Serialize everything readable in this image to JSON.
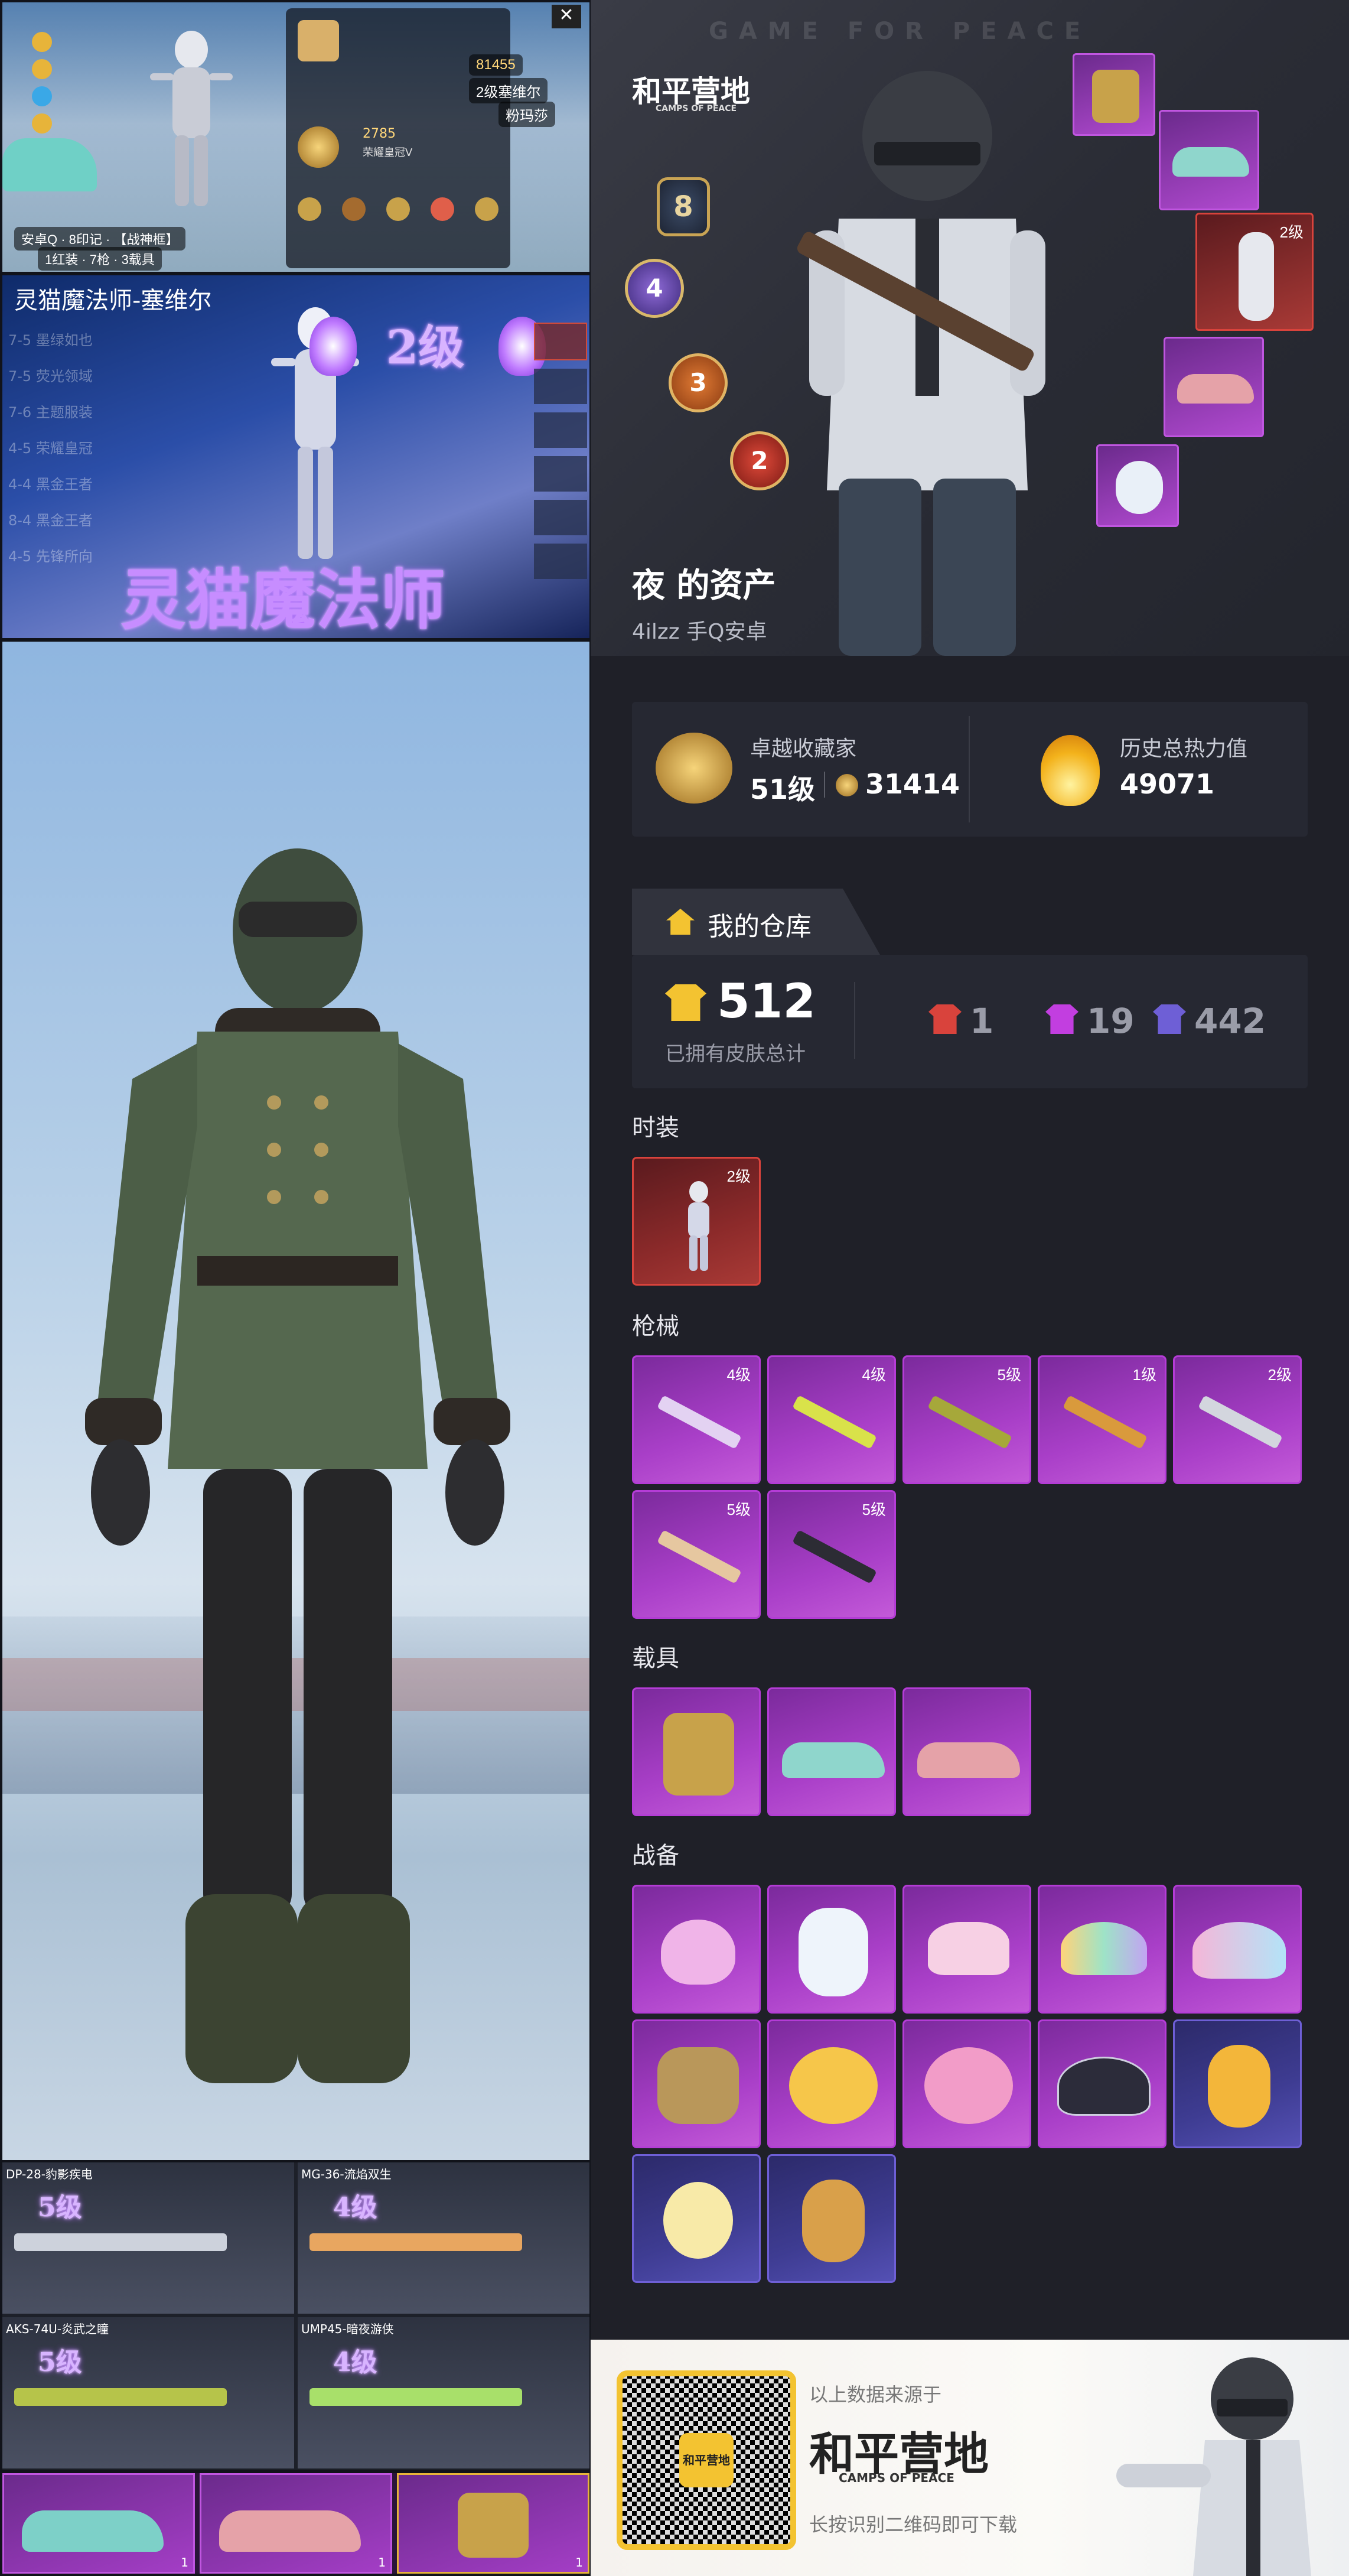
{
  "left": {
    "top_panel": {
      "fire_count": "81455",
      "name_tag_1": "2级塞维尔",
      "name_tag_2": "粉玛莎",
      "bottom_line_1": "安卓Q · 8印记 · 【战神框】",
      "bottom_line_2": "1红装 · 7枪 · 3载具",
      "rank_number": "2785",
      "rank_name": "荣耀皇冠V"
    },
    "skin_panel": {
      "header": "灵猫魔法师-塞维尔",
      "level_text": "2级",
      "big_title": "灵猫魔法师",
      "menu": [
        "7-5 墨绿如也",
        "7-5 荧光领域",
        "7-6 主题服装",
        "4-5 荣耀皇冠",
        "4-4 黑金王者",
        "8-4 黑金王者",
        "4-5 先锋所向"
      ]
    },
    "weapon_panels": [
      {
        "title": "DP-28-豹影疾电",
        "level": "5级"
      },
      {
        "title": "MG-36-流焰双生",
        "level": "4级"
      },
      {
        "title": "AKS-74U-炎武之瞳",
        "level": "5级"
      },
      {
        "title": "UMP45-暗夜游侠",
        "level": "4级"
      }
    ],
    "vehicle_strip": [
      {
        "count": "1"
      },
      {
        "count": "1"
      },
      {
        "count": "1"
      }
    ]
  },
  "right": {
    "brand_watermark": "GAME  FOR  PEACE",
    "brand_cn": "和平营地",
    "brand_en": "CAMPS OF PEACE",
    "badges": [
      "8",
      "4",
      "3",
      "2"
    ],
    "user_title": "夜 的资产",
    "user_sub": "4ilzz  手Q安卓",
    "stats": {
      "collector_title": "卓越收藏家",
      "collector_level": "51级",
      "collector_points": "31414",
      "heat_title": "历史总热力值",
      "heat_value": "49071"
    },
    "warehouse": {
      "tab_label": "我的仓库",
      "total": "512",
      "total_label": "已拥有皮肤总计",
      "red": "1",
      "purple": "19",
      "blue": "442"
    },
    "sections": {
      "fashion": "时装",
      "guns": "枪械",
      "vehicles": "载具",
      "gear": "战备"
    },
    "fashion_items": [
      {
        "level": "2级"
      }
    ],
    "gun_items": [
      {
        "level": "4级"
      },
      {
        "level": "4级"
      },
      {
        "level": "5级"
      },
      {
        "level": "1级"
      },
      {
        "level": "2级"
      },
      {
        "level": "5级"
      },
      {
        "level": "5级"
      }
    ],
    "hero_side_item_level": "2级",
    "colors": {
      "red": "#d9433c",
      "purple": "#c23ee0",
      "blue": "#6e5fd6",
      "gold": "#f3c331"
    }
  },
  "footer": {
    "source_text": "以上数据来源于",
    "brand_cn": "和平营地",
    "brand_en": "CAMPS OF PEACE",
    "hint": "长按识别二维码即可下载",
    "qr_center": "和平营地"
  }
}
